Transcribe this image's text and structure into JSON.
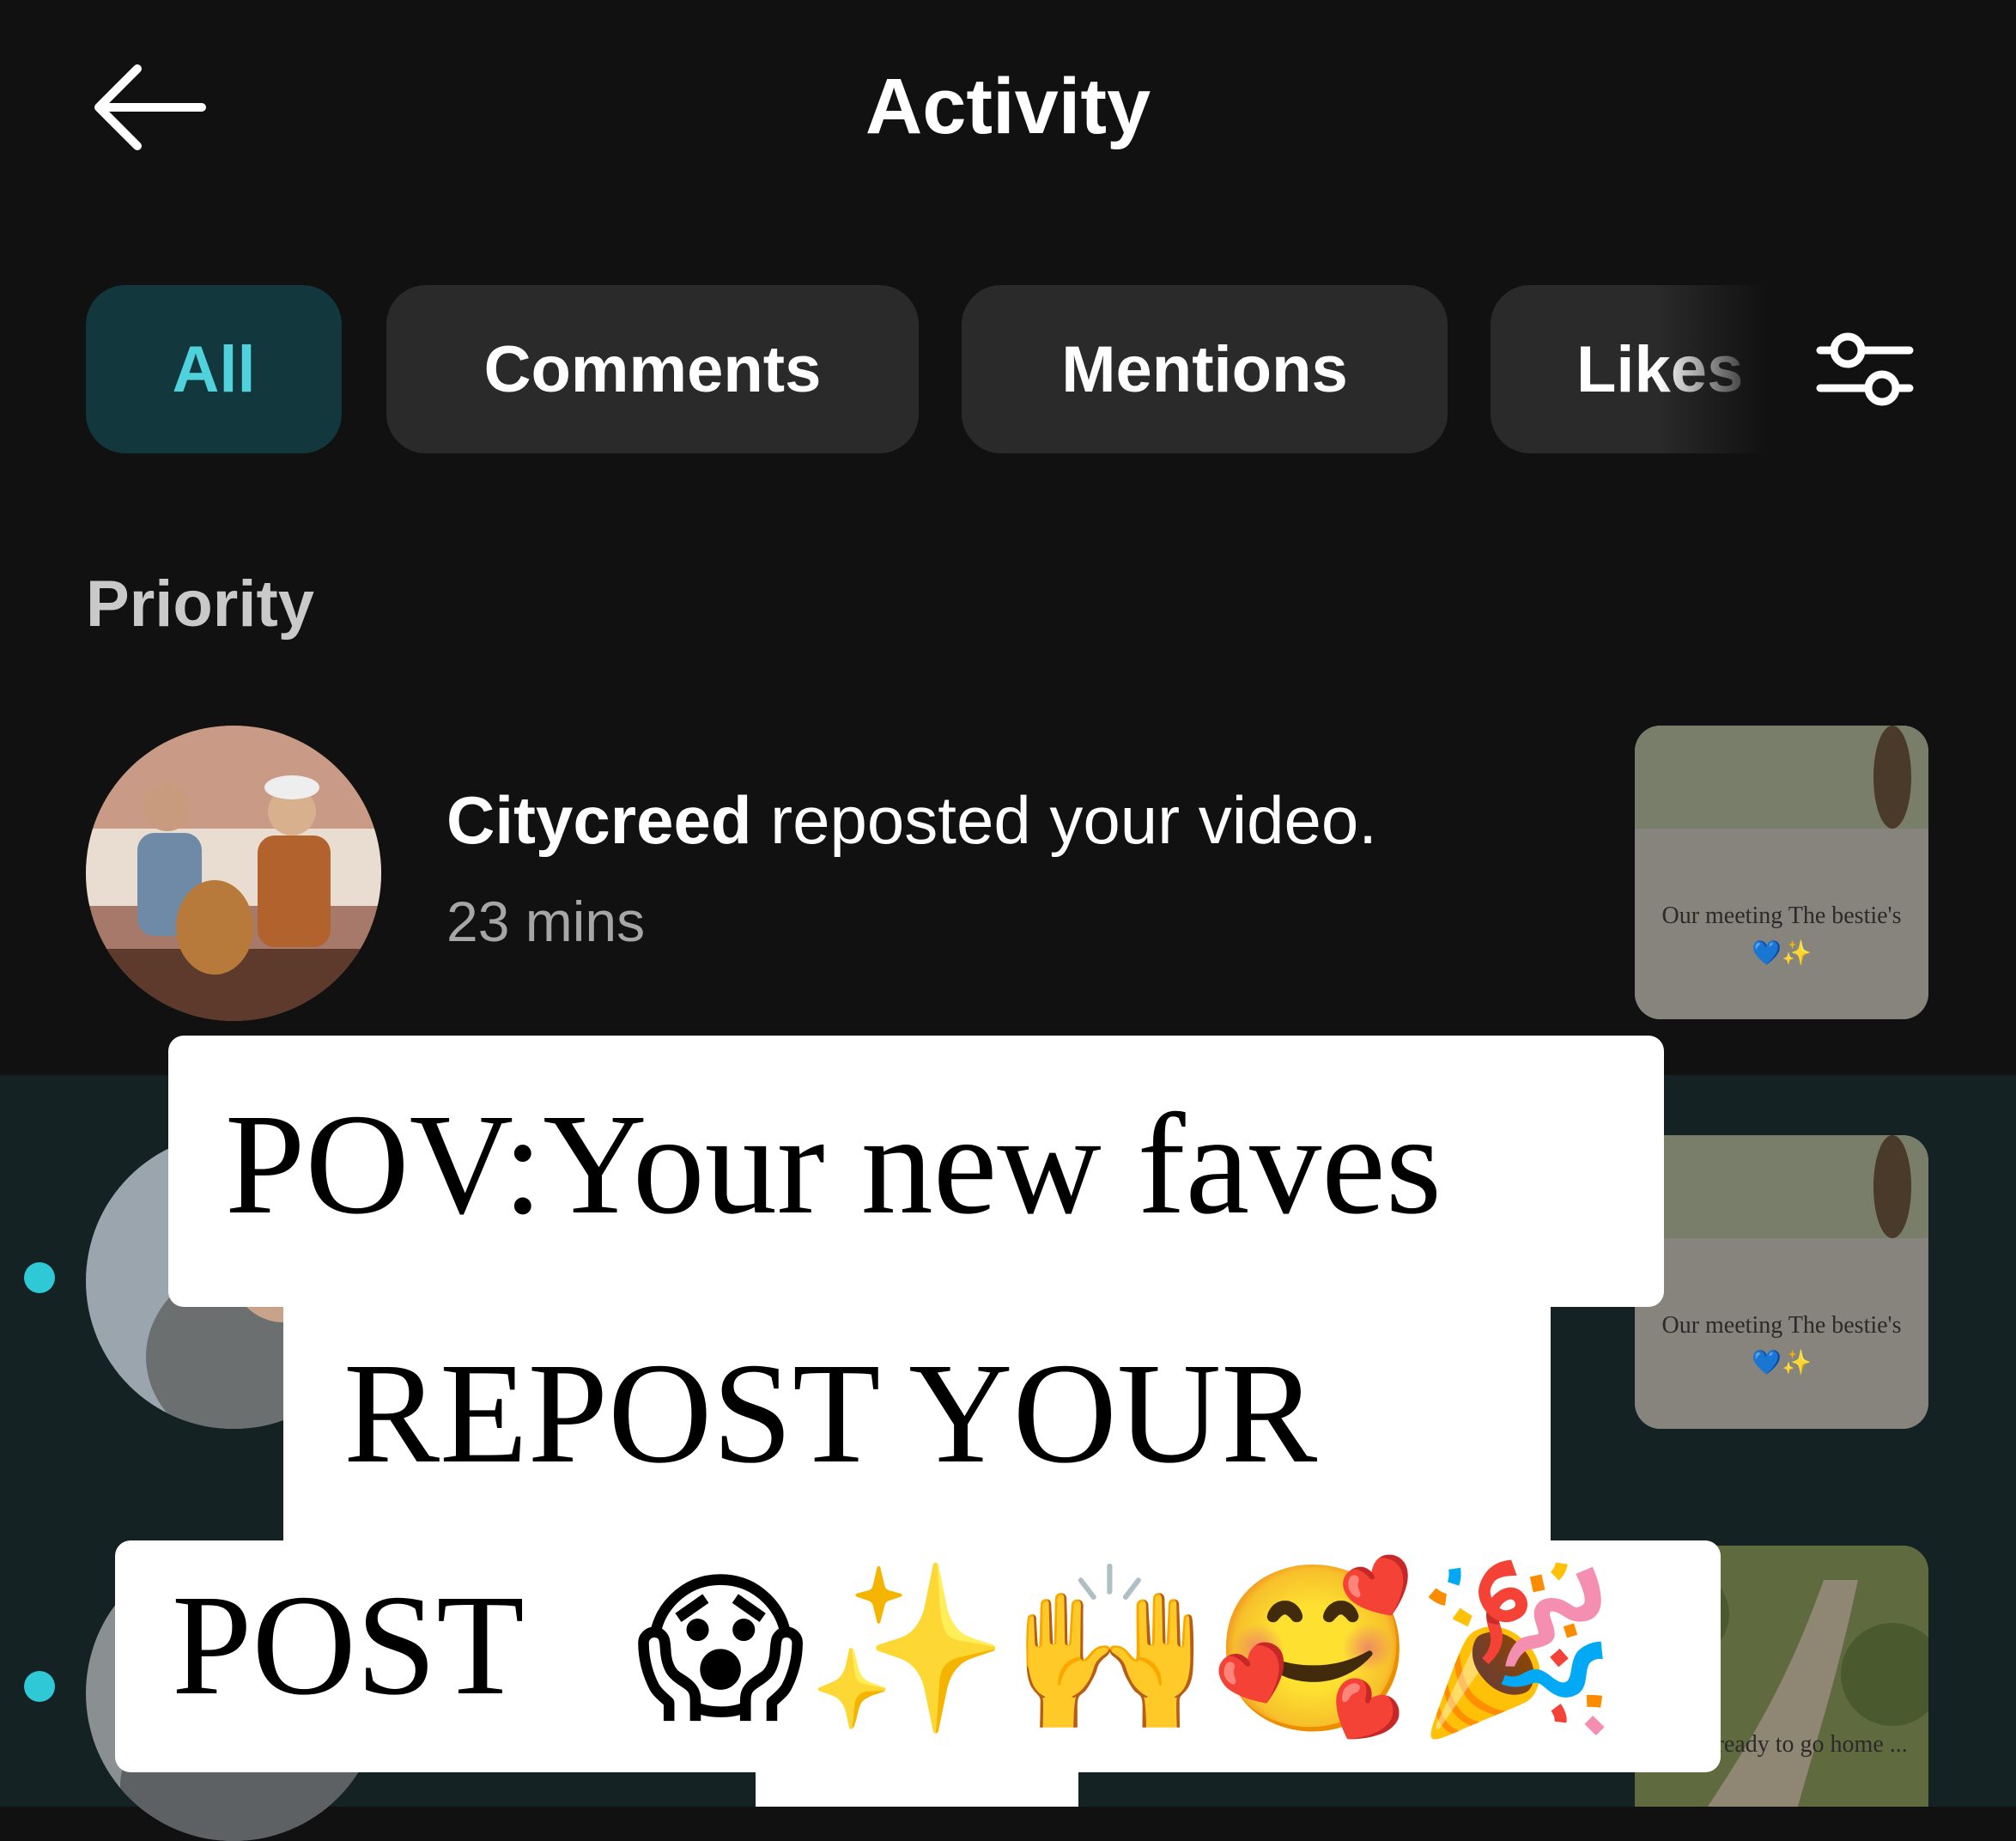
{
  "header": {
    "title": "Activity",
    "back_icon": "arrow-left-icon"
  },
  "tabs": [
    {
      "label": "All",
      "active": true
    },
    {
      "label": "Comments",
      "active": false
    },
    {
      "label": "Mentions",
      "active": false
    },
    {
      "label": "Likes !",
      "active": false
    }
  ],
  "filter_icon": "sliders-icon",
  "section": {
    "title": "Priority"
  },
  "notifications": [
    {
      "username": "Citycreed",
      "action": " reposted your video.",
      "time": "23 mins",
      "thumb_caption": "Our meeting The bestie's 💙✨",
      "unread": false
    },
    {
      "thumb_caption": "Our meeting The bestie's 💙✨",
      "unread": true
    },
    {
      "thumb_caption": "...he's ready to go home ...",
      "unread": true
    }
  ],
  "overlay_caption": {
    "line1": "POV:Your new faves",
    "line2": "REPOST YOUR",
    "line3": "POST",
    "emojis": "😱✨🙌🥰🎉"
  },
  "colors": {
    "background": "#111111",
    "unread_background": "#142224",
    "active_tab_bg": "#12373c",
    "active_tab_text": "#4fd2dc",
    "unread_dot": "#2ec8d6"
  }
}
